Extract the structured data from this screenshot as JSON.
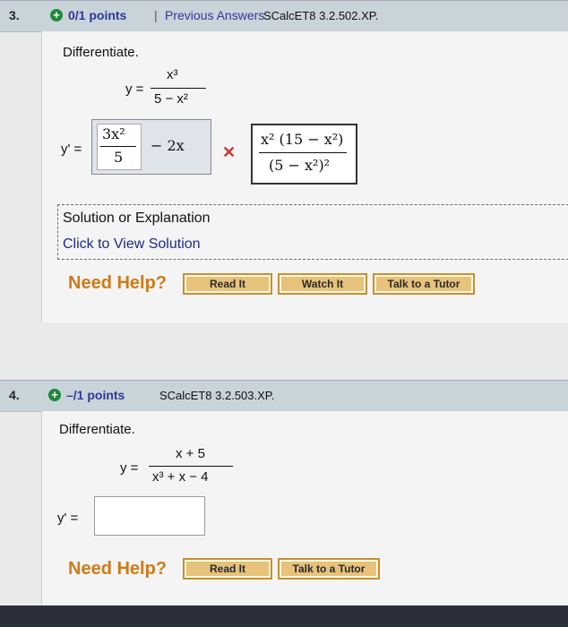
{
  "q3": {
    "number": "3.",
    "points": "0/1 points",
    "separator": "|",
    "previous_answers": "Previous Answers",
    "code": "SCalcET8 3.2.502.XP.",
    "instruction": "Differentiate.",
    "fn_lhs": "y =",
    "fn_num": "x³",
    "fn_den": "5 − x²",
    "deriv_lhs": "y' =",
    "ans_num": "3x²",
    "ans_den": "5",
    "ans_tail": "− 2x",
    "wrong_mark": "✕",
    "correct_num": "x² (15 − x²)",
    "correct_den": "(5 − x²)²",
    "solution_title": "Solution or Explanation",
    "solution_link": "Click to View Solution",
    "need_help": "Need Help?",
    "buttons": [
      "Read It",
      "Watch It",
      "Talk to a Tutor"
    ]
  },
  "q4": {
    "number": "4.",
    "points": "–/1 points",
    "code": "SCalcET8 3.2.503.XP.",
    "instruction": "Differentiate.",
    "fn_lhs": "y =",
    "fn_num": "x + 5",
    "fn_den": "x³ + x − 4",
    "deriv_lhs": "y' =",
    "input_value": "",
    "need_help": "Need Help?",
    "buttons": [
      "Read It",
      "Talk to a Tutor"
    ]
  },
  "colors": {
    "header_bg": "#c9d3da",
    "link_blue": "#2a3a9a",
    "help_orange": "#d07a18",
    "wrong_red": "#d23030",
    "button_bg": "#e7c27a"
  }
}
